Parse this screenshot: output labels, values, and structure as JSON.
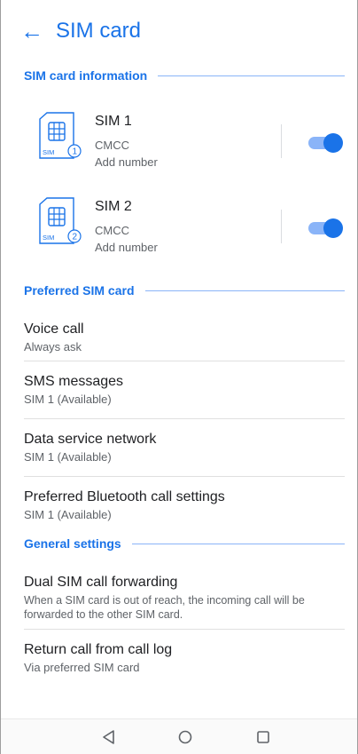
{
  "header": {
    "title": "SIM card"
  },
  "sections": {
    "sim_info": "SIM card information",
    "preferred": "Preferred SIM card",
    "general": "General settings"
  },
  "sims": [
    {
      "name": "SIM 1",
      "carrier": "CMCC",
      "number": "Add number",
      "badge": "SIM",
      "slot": "1",
      "enabled": true
    },
    {
      "name": "SIM 2",
      "carrier": "CMCC",
      "number": "Add number",
      "badge": "SIM",
      "slot": "2",
      "enabled": true
    }
  ],
  "preferred_items": [
    {
      "title": "Voice call",
      "subtitle": "Always ask"
    },
    {
      "title": "SMS messages",
      "subtitle": "SIM 1 (Available)"
    },
    {
      "title": "Data service network",
      "subtitle": "SIM 1 (Available)"
    },
    {
      "title": "Preferred Bluetooth call settings",
      "subtitle": "SIM 1 (Available)"
    }
  ],
  "general_items": [
    {
      "title": "Dual SIM call forwarding",
      "subtitle": "When a SIM card is out of reach, the incoming call will be forwarded to the other SIM card."
    },
    {
      "title": "Return call from call log",
      "subtitle": "Via preferred SIM card"
    }
  ],
  "colors": {
    "accent": "#1a73e8",
    "accent_light": "#8ab4f8"
  },
  "navigation": {
    "back": "back-triangle-icon",
    "home": "home-circle-icon",
    "recents": "recents-square-icon"
  }
}
